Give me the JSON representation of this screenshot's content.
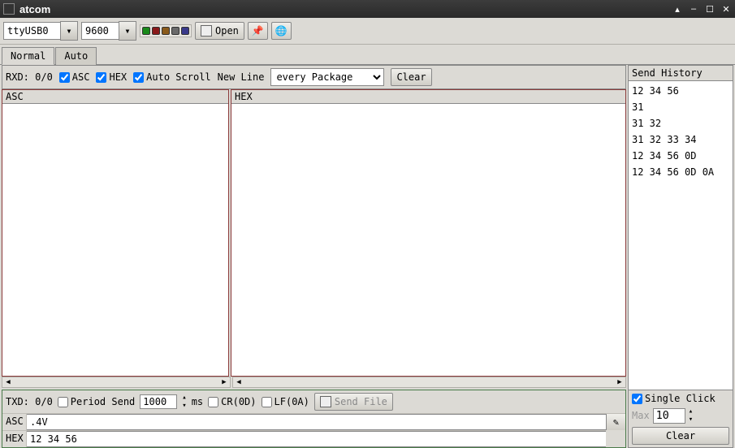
{
  "window": {
    "title": "atcom"
  },
  "toolbar": {
    "port": "ttyUSB0",
    "baud": "9600",
    "colors": [
      "#1a8a1a",
      "#8a1a1a",
      "#8a5a1a",
      "#6a6a6a",
      "#3a3a8a"
    ],
    "open_label": "Open"
  },
  "tabs": {
    "normal": "Normal",
    "auto": "Auto"
  },
  "rx": {
    "label": "RXD: 0/0",
    "asc_chk": true,
    "asc_label": "ASC",
    "hex_chk": true,
    "hex_label": "HEX",
    "autoscroll_chk": true,
    "autoscroll_label": "Auto Scroll",
    "newline_label": "New Line",
    "newline_value": "every Package",
    "clear_label": "Clear",
    "asc_hdr": "ASC",
    "hex_hdr": "HEX"
  },
  "tx": {
    "label": "TXD: 0/0",
    "period_chk": false,
    "period_label": "Period Send",
    "period_value": "1000",
    "period_unit": "ms",
    "cr_chk": false,
    "cr_label": "CR(0D)",
    "lf_chk": false,
    "lf_label": "LF(0A)",
    "sendfile_label": "Send File",
    "asc_label": "ASC",
    "asc_value": ".4V",
    "hex_label": "HEX",
    "hex_value": "12 34 56"
  },
  "history": {
    "title": "Send History",
    "items": [
      "12 34 56",
      "31",
      "31 32",
      "31 32 33 34",
      "12 34 56 0D",
      "12 34 56 0D 0A"
    ],
    "single_click_chk": true,
    "single_click_label": "Single Click",
    "max_label": "Max",
    "max_value": "10",
    "clear_label": "Clear"
  }
}
